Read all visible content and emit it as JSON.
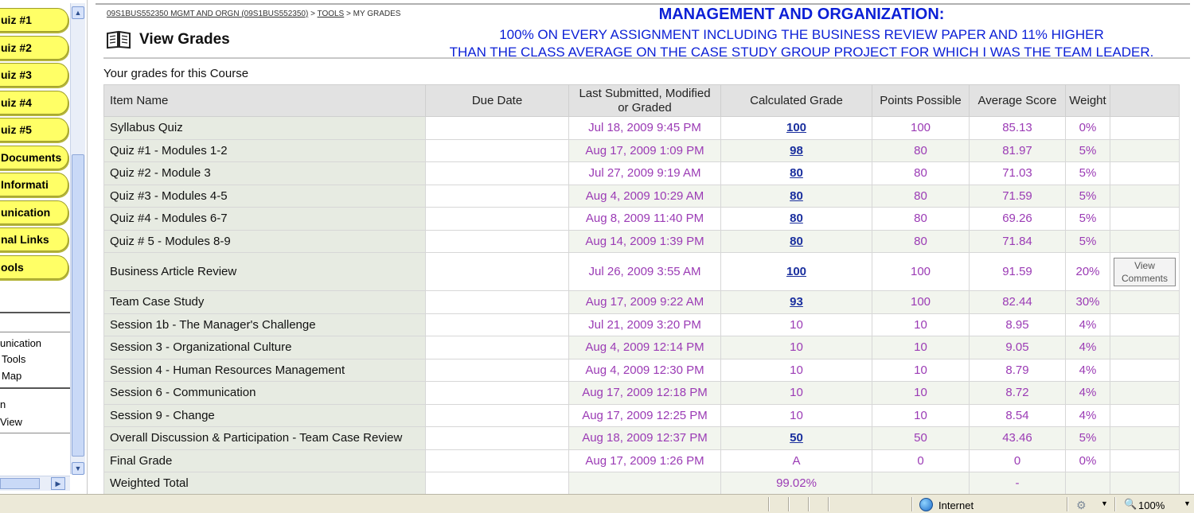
{
  "sidebar": {
    "pills": [
      "uiz #1",
      "uiz #2",
      "uiz #3",
      "uiz #4",
      "uiz #5",
      "Documents",
      "Informati",
      "unication",
      "nal Links",
      "ools"
    ],
    "links": [
      "unication",
      "Tools",
      "Map",
      "n",
      "View"
    ]
  },
  "breadcrumb": {
    "course_link": "09S1BUS552350 MGMT AND ORGN (09S1BUS552350)",
    "tools_link": "TOOLS",
    "current": "MY GRADES",
    "separator": ">"
  },
  "page": {
    "title": "View Grades",
    "caption": "Your grades for this Course"
  },
  "annotation": {
    "heading": "MANAGEMENT AND ORGANIZATION:",
    "line1": "100% ON EVERY ASSIGNMENT INCLUDING THE BUSINESS REVIEW PAPER AND 11% HIGHER",
    "line2": "THAN THE CLASS AVERAGE ON THE CASE STUDY GROUP PROJECT FOR WHICH I WAS THE TEAM LEADER."
  },
  "table": {
    "headers": {
      "item": "Item Name",
      "due": "Due Date",
      "last1": "Last Submitted, Modified",
      "last2": "or Graded",
      "grade": "Calculated Grade",
      "points": "Points Possible",
      "avg": "Average Score",
      "weight": "Weight"
    },
    "rows": [
      {
        "item": "Syllabus Quiz",
        "due": "",
        "date": "Jul 18, 2009 9:45 PM",
        "grade": "100",
        "grade_link": true,
        "points": "100",
        "avg": "85.13",
        "weight": "0%",
        "action": ""
      },
      {
        "item": "Quiz #1 - Modules 1-2",
        "due": "",
        "date": "Aug 17, 2009 1:09 PM",
        "grade": "98",
        "grade_link": true,
        "points": "80",
        "avg": "81.97",
        "weight": "5%",
        "action": ""
      },
      {
        "item": "Quiz #2 - Module 3",
        "due": "",
        "date": "Jul 27, 2009 9:19 AM",
        "grade": "80",
        "grade_link": true,
        "points": "80",
        "avg": "71.03",
        "weight": "5%",
        "action": ""
      },
      {
        "item": "Quiz #3 - Modules 4-5",
        "due": "",
        "date": "Aug 4, 2009 10:29 AM",
        "grade": "80",
        "grade_link": true,
        "points": "80",
        "avg": "71.59",
        "weight": "5%",
        "action": ""
      },
      {
        "item": "Quiz #4 - Modules 6-7",
        "due": "",
        "date": "Aug 8, 2009 11:40 PM",
        "grade": "80",
        "grade_link": true,
        "points": "80",
        "avg": "69.26",
        "weight": "5%",
        "action": ""
      },
      {
        "item": "Quiz # 5 - Modules 8-9",
        "due": "",
        "date": "Aug 14, 2009 1:39 PM",
        "grade": "80",
        "grade_link": true,
        "points": "80",
        "avg": "71.84",
        "weight": "5%",
        "action": ""
      },
      {
        "item": "Business Article Review",
        "due": "",
        "date": "Jul 26, 2009 3:55 AM",
        "grade": "100",
        "grade_link": true,
        "points": "100",
        "avg": "91.59",
        "weight": "20%",
        "action": "View Comments",
        "tall": true
      },
      {
        "item": "Team Case Study",
        "due": "",
        "date": "Aug 17, 2009 9:22 AM",
        "grade": "93",
        "grade_link": true,
        "points": "100",
        "avg": "82.44",
        "weight": "30%",
        "action": ""
      },
      {
        "item": "Session 1b - The Manager's Challenge",
        "due": "",
        "date": "Jul 21, 2009 3:20 PM",
        "grade": "10",
        "grade_link": false,
        "points": "10",
        "avg": "8.95",
        "weight": "4%",
        "action": ""
      },
      {
        "item": "Session 3 - Organizational Culture",
        "due": "",
        "date": "Aug 4, 2009 12:14 PM",
        "grade": "10",
        "grade_link": false,
        "points": "10",
        "avg": "9.05",
        "weight": "4%",
        "action": ""
      },
      {
        "item": "Session 4 - Human Resources Management",
        "due": "",
        "date": "Aug 4, 2009 12:30 PM",
        "grade": "10",
        "grade_link": false,
        "points": "10",
        "avg": "8.79",
        "weight": "4%",
        "action": ""
      },
      {
        "item": "Session 6 - Communication",
        "due": "",
        "date": "Aug 17, 2009 12:18 PM",
        "grade": "10",
        "grade_link": false,
        "points": "10",
        "avg": "8.72",
        "weight": "4%",
        "action": ""
      },
      {
        "item": "Session 9 - Change",
        "due": "",
        "date": "Aug 17, 2009 12:25 PM",
        "grade": "10",
        "grade_link": false,
        "points": "10",
        "avg": "8.54",
        "weight": "4%",
        "action": ""
      },
      {
        "item": "Overall Discussion & Participation - Team Case Review",
        "due": "",
        "date": "Aug 18, 2009 12:37 PM",
        "grade": "50",
        "grade_link": true,
        "points": "50",
        "avg": "43.46",
        "weight": "5%",
        "action": ""
      },
      {
        "item": "Final Grade",
        "due": "",
        "date": "Aug 17, 2009 1:26 PM",
        "grade": "A",
        "grade_link": false,
        "points": "0",
        "avg": "0",
        "weight": "0%",
        "action": ""
      },
      {
        "item": "Weighted Total",
        "due": "",
        "date": "",
        "grade": "99.02%",
        "grade_link": false,
        "points": "",
        "avg": "-",
        "weight": "",
        "action": ""
      }
    ]
  },
  "statusbar": {
    "zone": "Internet",
    "zoom": "100%"
  },
  "colors": {
    "annotation": "#0b1fd6",
    "sidebar_pill": "#ffff66",
    "value_text": "#9b3bb5",
    "grade_link": "#1a2f9e"
  }
}
